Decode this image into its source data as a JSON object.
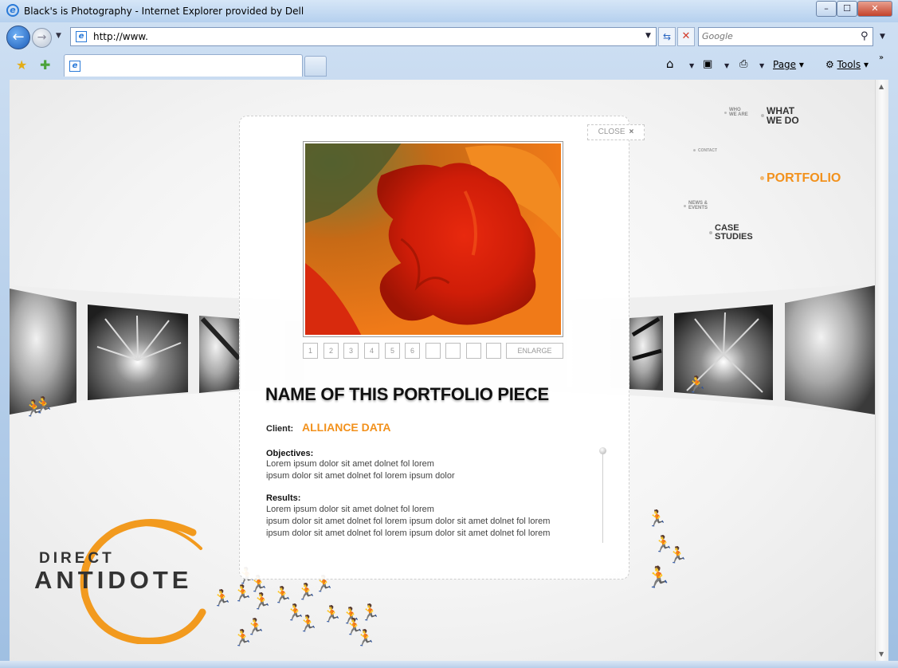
{
  "window": {
    "title": "Black's is Photography - Internet Explorer provided by Dell",
    "min_glyph": "–",
    "max_glyph": "☐",
    "close_glyph": "✕"
  },
  "address_bar": {
    "url": "http://www.",
    "search_placeholder": "Google"
  },
  "command_bar": {
    "page_label": "Page",
    "tools_label": "Tools"
  },
  "site_nav": {
    "who_we_are": [
      "WHO",
      "WE ARE"
    ],
    "what_we_do": [
      "WHAT",
      "WE DO"
    ],
    "contact": "CONTACT",
    "portfolio": "PORTFOLIO",
    "news_events": [
      "NEWS &",
      "EVENTS"
    ],
    "case_studies": [
      "CASE",
      "STUDIES"
    ]
  },
  "logo": {
    "line1": "DIRECT",
    "line2": "ANTIDOTE"
  },
  "modal": {
    "close_label": "CLOSE",
    "close_glyph": "×",
    "pages": [
      "1",
      "2",
      "3",
      "4",
      "5",
      "6",
      "",
      "",
      "",
      ""
    ],
    "enlarge_label": "ENLARGE",
    "title": "NAME OF THIS PORTFOLIO PIECE",
    "client_label": "Client:",
    "client_name": "ALLIANCE DATA",
    "objectives_heading": "Objectives:",
    "objectives_lines": [
      "Lorem ipsum dolor sit amet dolnet fol lorem",
      "ipsum dolor sit amet dolnet fol lorem ipsum dolor"
    ],
    "results_heading": "Results:",
    "results_lines": [
      "Lorem ipsum dolor sit amet dolnet fol lorem",
      "ipsum dolor sit amet dolnet fol lorem ipsum dolor sit amet dolnet fol lorem",
      "ipsum dolor sit amet dolnet fol lorem ipsum dolor sit amet dolnet fol lorem"
    ]
  },
  "colors": {
    "accent": "#f2911c",
    "figure": "#f29a1e",
    "text": "#333333"
  },
  "icons": {
    "figure_glyph": "🯅"
  }
}
